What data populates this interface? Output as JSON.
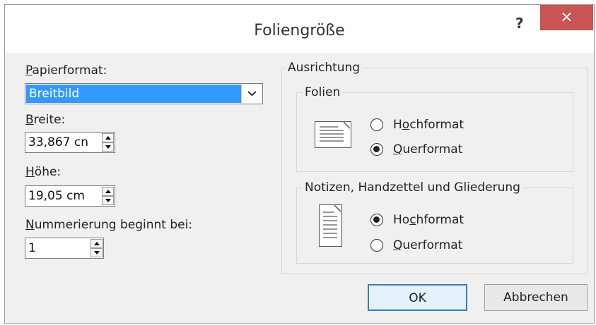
{
  "title": "Foliengröße",
  "titlebar": {
    "help_label": "?",
    "close_label": "×"
  },
  "paper": {
    "label_first": "P",
    "label_rest": "apierformat:",
    "value": "Breitbild"
  },
  "width": {
    "label_first": "B",
    "label_rest": "reite:",
    "value": "33,867  cn"
  },
  "height": {
    "label_first": "H",
    "label_rest": "öhe:",
    "value": "19,05  cm"
  },
  "numbering": {
    "label_first": "N",
    "label_rest": "ummerierung beginnt bei:",
    "value": "1"
  },
  "orientation": {
    "legend": "Ausrichtung",
    "slides": {
      "legend": "Folien",
      "portrait": {
        "pre": "H",
        "u": "o",
        "post": "chformat",
        "selected": false
      },
      "landscape": {
        "pre": "",
        "u": "Q",
        "post": "uerformat",
        "selected": true
      }
    },
    "notes": {
      "legend": "Notizen, Handzettel und Gliederung",
      "portrait": {
        "pre": "Ho",
        "u": "c",
        "post": "hformat",
        "selected": true
      },
      "landscape": {
        "pre": "",
        "u": "Q",
        "post": "uerformat",
        "selected": false
      }
    }
  },
  "buttons": {
    "ok": "OK",
    "cancel": "Abbrechen"
  },
  "icons": {
    "dropdown": "chevron-down-icon",
    "spin": "spin-arrows-icon"
  },
  "colors": {
    "selection": "#3399ff",
    "close": "#c85454",
    "ok_border": "#3c7fb1"
  }
}
